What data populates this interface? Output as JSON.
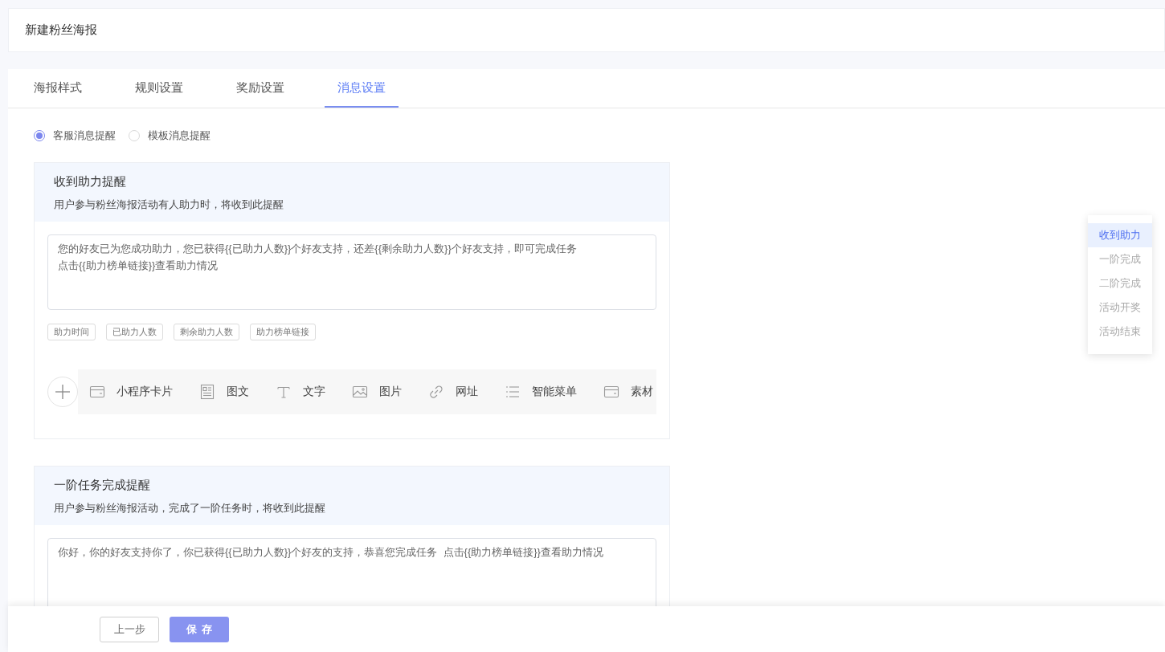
{
  "page_title": "新建粉丝海报",
  "tabs": [
    {
      "label": "海报样式",
      "selected": false
    },
    {
      "label": "规则设置",
      "selected": false
    },
    {
      "label": "奖励设置",
      "selected": false
    },
    {
      "label": "消息设置",
      "selected": true
    }
  ],
  "reminder_types": [
    {
      "label": "客服消息提醒",
      "selected": true
    },
    {
      "label": "模板消息提醒",
      "selected": false
    }
  ],
  "message_cards": [
    {
      "title": "收到助力提醒",
      "description": "用户参与粉丝海报活动有人助力时，将收到此提醒",
      "message_lines": [
        "您的好友已为您成功助力，您已获得{{已助力人数}}个好友支持，还差{{剩余助力人数}}个好友支持，即可完成任务",
        "点击{{助力榜单链接}}查看助力情况"
      ],
      "variables": [
        "助力时间",
        "已助力人数",
        "剩余助力人数",
        "助力榜单链接"
      ],
      "content_types": [
        {
          "kind": "miniprogram",
          "label": "小程序卡片"
        },
        {
          "kind": "news",
          "label": "图文"
        },
        {
          "kind": "text",
          "label": "文字"
        },
        {
          "kind": "image",
          "label": "图片"
        },
        {
          "kind": "link",
          "label": "网址"
        },
        {
          "kind": "menu",
          "label": "智能菜单"
        },
        {
          "kind": "material",
          "label": "素材"
        }
      ]
    },
    {
      "title": "一阶任务完成提醒",
      "description": "用户参与粉丝海报活动，完成了一阶任务时，将收到此提醒",
      "message_lines": [
        "你好，你的好友支持你了，你已获得{{已助力人数}}个好友的支持，恭喜您完成任务  点击{{助力榜单链接}}查看助力情况"
      ]
    }
  ],
  "side_nav": [
    {
      "label": "收到助力",
      "selected": true
    },
    {
      "label": "一阶完成",
      "selected": false
    },
    {
      "label": "二阶完成",
      "selected": false
    },
    {
      "label": "活动开奖",
      "selected": false
    },
    {
      "label": "活动结束",
      "selected": false
    }
  ],
  "buttons": [
    {
      "kind": "secondary",
      "label": "上一步"
    },
    {
      "kind": "primary",
      "label": "保存"
    }
  ]
}
